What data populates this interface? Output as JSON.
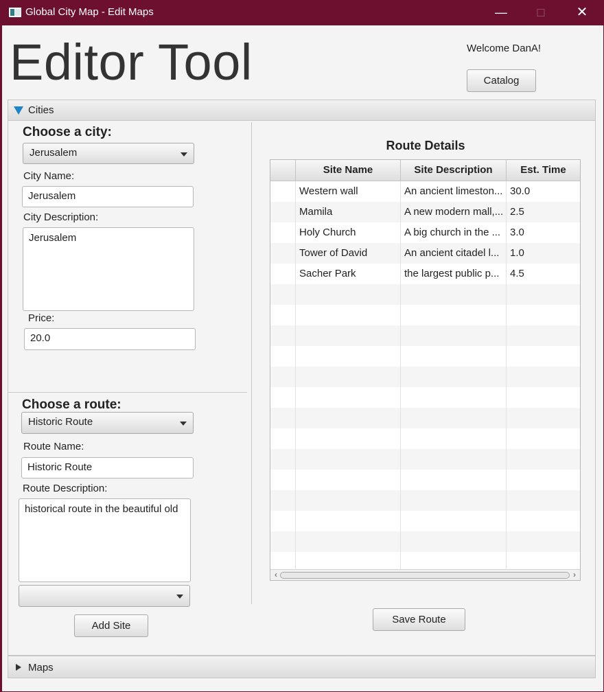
{
  "window": {
    "title": "Global City Map - Edit Maps",
    "minimize": "—",
    "maximize": "□",
    "close": "✕"
  },
  "header": {
    "app_title": "Editor Tool",
    "welcome": "Welcome DanA!",
    "catalog_label": "Catalog"
  },
  "cities_pane": {
    "label": "Cities",
    "choose_city": "Choose a city:",
    "selected_city": "Jerusalem",
    "city_name_label": "City Name:",
    "city_name_value": "Jerusalem",
    "city_desc_label": "City Description:",
    "city_desc_value": "Jerusalem",
    "price_label": "Price:",
    "price_value": "20.0",
    "choose_route": "Choose a route:",
    "selected_route": "Historic Route",
    "route_name_label": "Route Name:",
    "route_name_value": "Historic Route",
    "route_desc_label": "Route Description:",
    "route_desc_value": "historical route in the beautiful old",
    "site_selected": "",
    "add_site_label": "Add Site",
    "route_details_title": "Route Details",
    "save_route_label": "Save Route"
  },
  "table": {
    "columns": [
      "",
      "Site Name",
      "Site Description",
      "Est. Time"
    ],
    "rows": [
      [
        "",
        "Western wall",
        "An ancient limeston...",
        "30.0"
      ],
      [
        "",
        "Mamila",
        "A new modern mall,...",
        "2.5"
      ],
      [
        "",
        "Holy Church",
        "A big church in the ...",
        "3.0"
      ],
      [
        "",
        "Tower of David",
        "An ancient citadel l...",
        "1.0"
      ],
      [
        "",
        "Sacher Park",
        "the largest public p...",
        "4.5"
      ]
    ],
    "empty_rows": 14
  },
  "maps_pane": {
    "label": "Maps"
  },
  "colors": {
    "titlebar": "#6d0f2e",
    "expand_arrow": "#1e84c6",
    "background": "#f4f4f4"
  },
  "icons": {
    "app": "app-window-icon",
    "expanded": "triangle-down-icon",
    "collapsed": "triangle-right-icon",
    "dropdown": "chevron-down-icon"
  }
}
